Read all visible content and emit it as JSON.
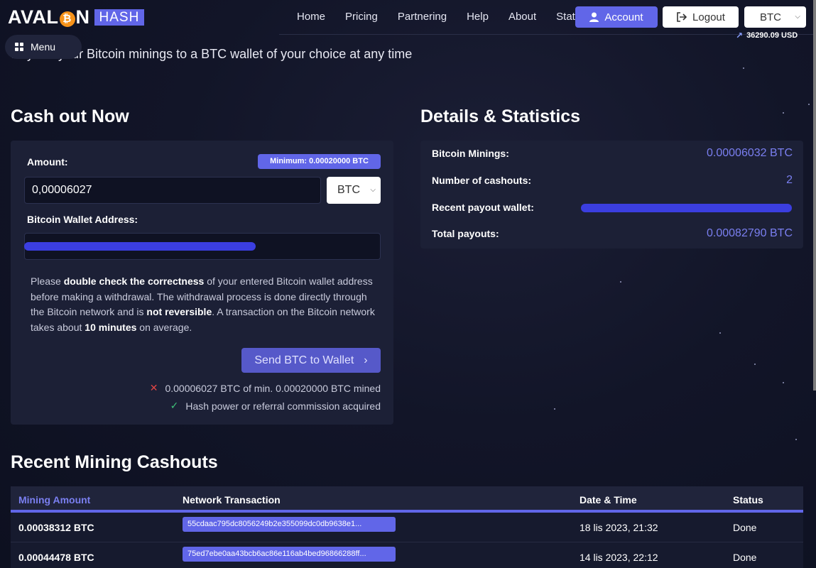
{
  "logo": {
    "text_left": "AVAL",
    "coin_glyph": "₿",
    "text_right": "N",
    "badge": "HASH"
  },
  "nav": [
    "Home",
    "Pricing",
    "Partnering",
    "Help",
    "About",
    "Stats"
  ],
  "header": {
    "account_label": "Account",
    "logout_label": "Logout",
    "currency": "BTC",
    "btc_price": "36290.09 USD"
  },
  "menu_label": "Menu",
  "subtitle": "Pay out your Bitcoin minings to a BTC wallet of your choice at any time",
  "cashout": {
    "title": "Cash out Now",
    "amount_label": "Amount:",
    "minimum_badge": "Minimum: 0.00020000 BTC",
    "amount_value": "0,00006027",
    "unit": "BTC",
    "wallet_label": "Bitcoin Wallet Address:",
    "notice_1": "Please ",
    "notice_b1": "double check the correctness",
    "notice_2": " of your entered Bitcoin wallet address before making a withdrawal. The withdrawal process is done directly through the Bitcoin network and is ",
    "notice_b2": "not reversible",
    "notice_3": ". A transaction on the Bitcoin network takes about ",
    "notice_b3": "10 minutes",
    "notice_4": " on average.",
    "send_label": "Send BTC to Wallet",
    "req_fail": "0.00006027 BTC of min. 0.00020000 BTC mined",
    "req_ok": "Hash power or referral commission acquired"
  },
  "stats": {
    "title": "Details & Statistics",
    "rows": [
      {
        "label": "Bitcoin Minings:",
        "value": "0.00006032 BTC"
      },
      {
        "label": "Number of cashouts:",
        "value": "2"
      },
      {
        "label": "Recent payout wallet:",
        "value": ""
      },
      {
        "label": "Total payouts:",
        "value": "0.00082790 BTC"
      }
    ]
  },
  "cashouts": {
    "title": "Recent Mining Cashouts",
    "headers": [
      "Mining Amount",
      "Network Transaction",
      "Date & Time",
      "Status"
    ],
    "rows": [
      {
        "amount": "0.00038312 BTC",
        "tx": "55cdaac795dc8056249b2e355099dc0db9638e1...",
        "date": "18 lis 2023, 21:32",
        "status": "Done"
      },
      {
        "amount": "0.00044478 BTC",
        "tx": "75ed7ebe0aa43bcb6ac86e116ab4bed96866288ff...",
        "date": "14 lis 2023, 22:12",
        "status": "Done"
      }
    ]
  }
}
